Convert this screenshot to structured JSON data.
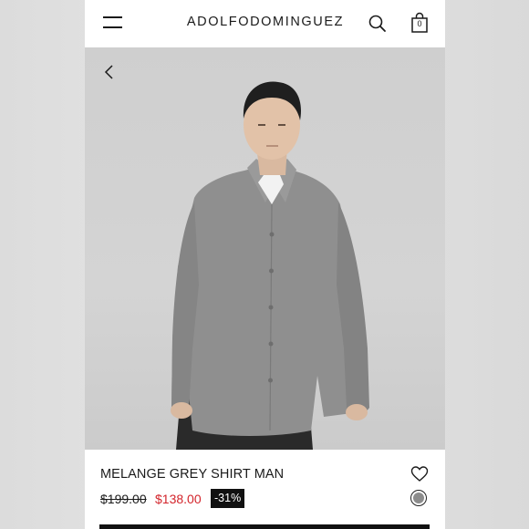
{
  "header": {
    "brand": "ADOLFODOMINGUEZ",
    "menu_icon": "hamburger-menu-icon",
    "search_icon": "search-icon",
    "bag_icon": "shopping-bag-icon",
    "bag_count": "0"
  },
  "gallery": {
    "back_icon": "chevron-left-icon"
  },
  "product": {
    "name": "MELANGE GREY SHIRT MAN",
    "old_price": "$199.00",
    "new_price": "$138.00",
    "discount": "-31%",
    "wishlist_icon": "heart-icon",
    "swatch_color": "#8c8c8c"
  },
  "colors": {
    "sale": "#d3242b",
    "text": "#1a1a1a",
    "badge_bg": "#111111"
  }
}
